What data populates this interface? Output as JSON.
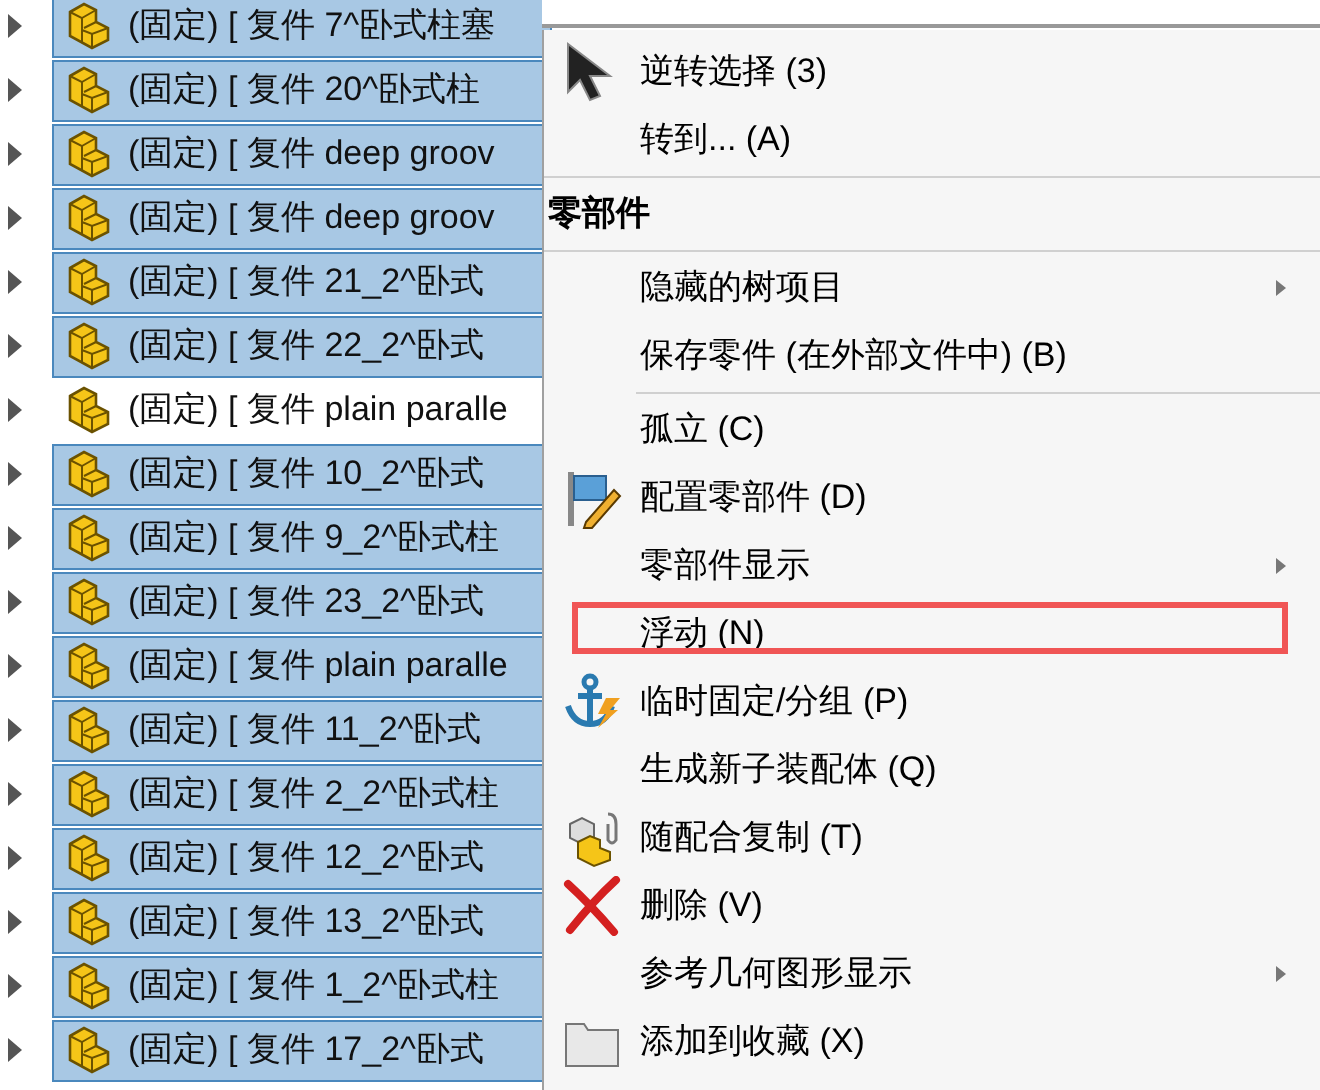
{
  "tree": {
    "rows": [
      {
        "label": "(固定) [ 复件 7^卧式柱塞",
        "selected": true
      },
      {
        "label": "(固定) [ 复件 20^卧式柱",
        "selected": true
      },
      {
        "label": "(固定) [ 复件 deep groov",
        "selected": true
      },
      {
        "label": "(固定) [ 复件 deep groov",
        "selected": true
      },
      {
        "label": "(固定) [ 复件 21_2^卧式",
        "selected": true
      },
      {
        "label": "(固定) [ 复件 22_2^卧式",
        "selected": true
      },
      {
        "label": "(固定) [ 复件 plain paralle",
        "selected": false
      },
      {
        "label": "(固定) [ 复件 10_2^卧式",
        "selected": true
      },
      {
        "label": "(固定) [ 复件 9_2^卧式柱",
        "selected": true
      },
      {
        "label": "(固定) [ 复件 23_2^卧式",
        "selected": true
      },
      {
        "label": "(固定) [ 复件 plain paralle",
        "selected": true
      },
      {
        "label": "(固定) [ 复件 11_2^卧式",
        "selected": true
      },
      {
        "label": "(固定) [ 复件 2_2^卧式柱",
        "selected": true
      },
      {
        "label": "(固定) [ 复件 12_2^卧式",
        "selected": true
      },
      {
        "label": "(固定) [ 复件 13_2^卧式",
        "selected": true
      },
      {
        "label": "(固定) [ 复件 1_2^卧式柱",
        "selected": true
      },
      {
        "label": "(固定) [ 复件 17_2^卧式",
        "selected": true
      }
    ]
  },
  "context_menu": {
    "items": [
      {
        "kind": "item",
        "label": "逆转选择 (3)",
        "submenu": false,
        "highlighted": false
      },
      {
        "kind": "item",
        "label": "转到... (A)",
        "submenu": false,
        "highlighted": false
      },
      {
        "kind": "separator",
        "indented": false
      },
      {
        "kind": "header",
        "label": "零部件"
      },
      {
        "kind": "separator",
        "indented": false
      },
      {
        "kind": "item",
        "label": "隐藏的树项目",
        "submenu": true,
        "highlighted": false
      },
      {
        "kind": "item",
        "label": "保存零件 (在外部文件中) (B)",
        "submenu": false,
        "highlighted": false
      },
      {
        "kind": "separator",
        "indented": true
      },
      {
        "kind": "item",
        "label": "孤立 (C)",
        "submenu": false,
        "highlighted": false
      },
      {
        "kind": "item",
        "label": "配置零部件 (D)",
        "submenu": false,
        "highlighted": false
      },
      {
        "kind": "item",
        "label": "零部件显示",
        "submenu": true,
        "highlighted": false
      },
      {
        "kind": "item",
        "label": "浮动 (N)",
        "submenu": false,
        "highlighted": true
      },
      {
        "kind": "item",
        "label": "临时固定/分组 (P)",
        "submenu": false,
        "highlighted": false
      },
      {
        "kind": "item",
        "label": "生成新子装配体 (Q)",
        "submenu": false,
        "highlighted": false
      },
      {
        "kind": "item",
        "label": "随配合复制 (T)",
        "submenu": false,
        "highlighted": false
      },
      {
        "kind": "item",
        "label": "删除 (V)",
        "submenu": false,
        "highlighted": false
      },
      {
        "kind": "item",
        "label": "参考几何图形显示",
        "submenu": true,
        "highlighted": false
      },
      {
        "kind": "item",
        "label": "添加到收藏 (X)",
        "submenu": false,
        "highlighted": false
      }
    ]
  }
}
